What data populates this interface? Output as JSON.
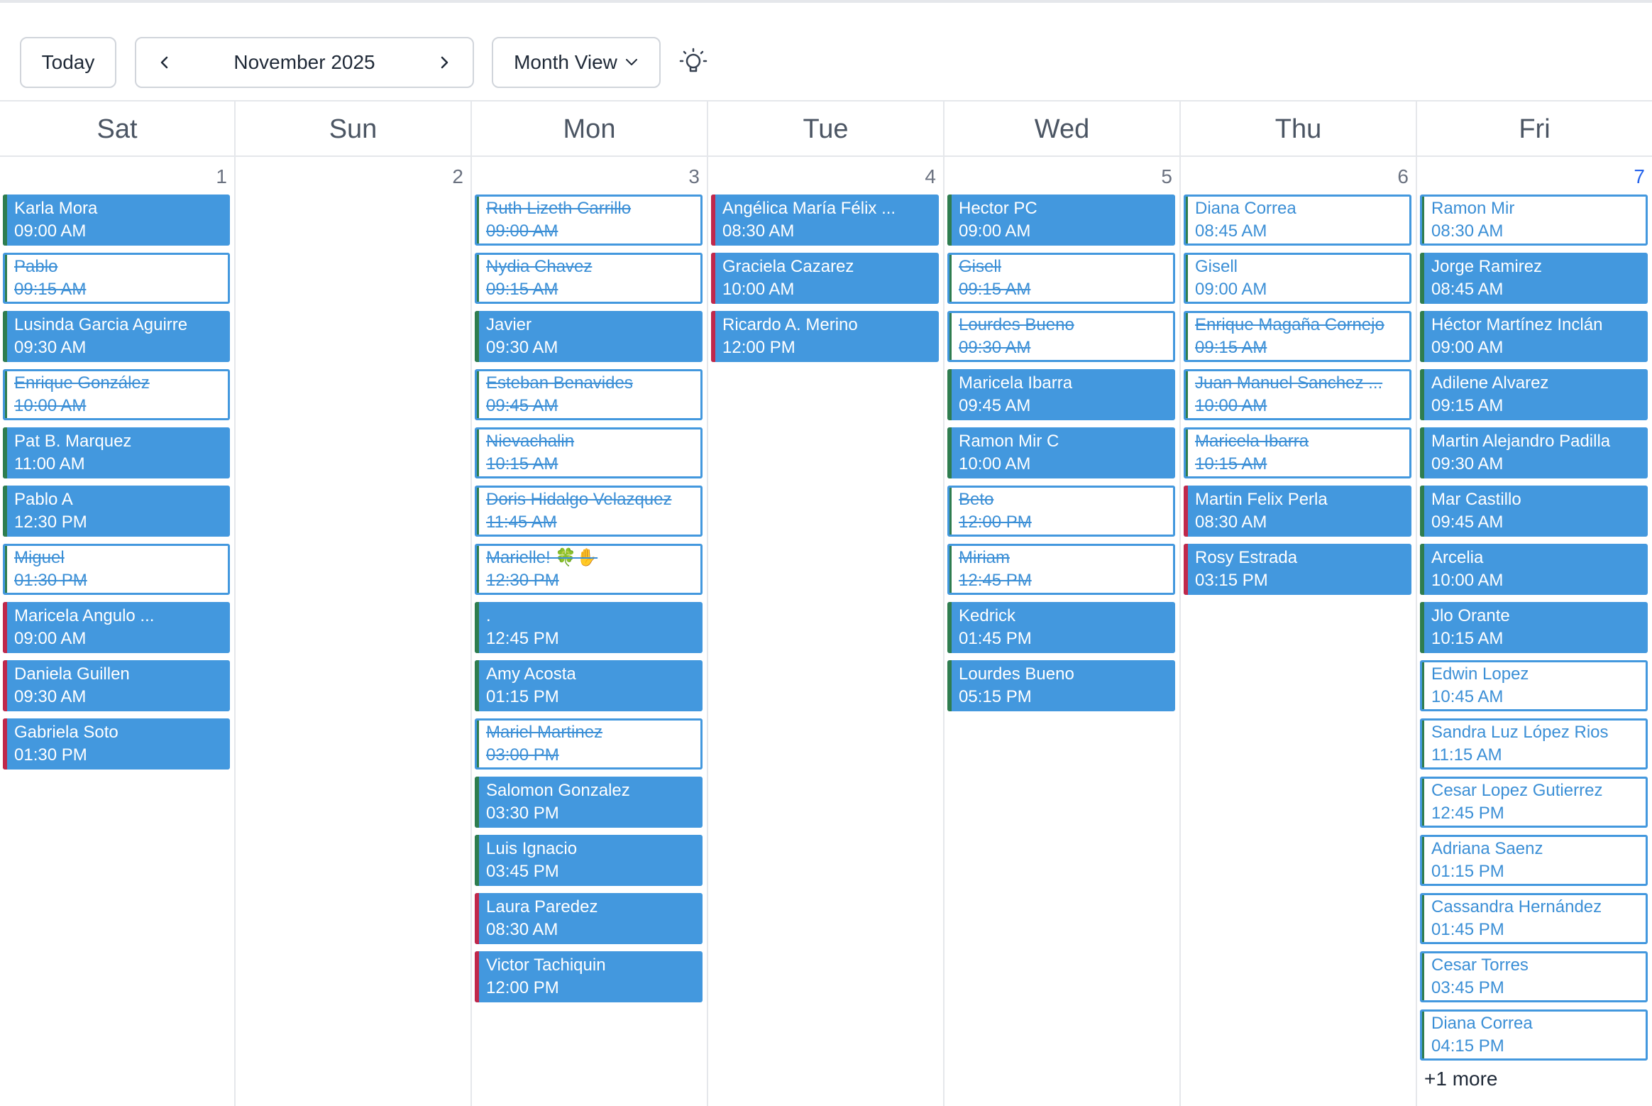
{
  "toolbar": {
    "today_label": "Today",
    "month_label": "November 2025",
    "view_label": "Month View",
    "prev_icon": "chevron-left-icon",
    "next_icon": "chevron-right-icon",
    "view_icon": "chevron-down-icon",
    "theme_icon": "lightbulb-icon"
  },
  "colors": {
    "event_blue": "#4398de",
    "bar_green": "#2f7d4f",
    "bar_red": "#c0284b",
    "today_blue": "#2563eb"
  },
  "weekdays": [
    "Sat",
    "Sun",
    "Mon",
    "Tue",
    "Wed",
    "Thu",
    "Fri"
  ],
  "days": [
    {
      "number": "1",
      "today": false,
      "events": [
        {
          "name": "Karla Mora",
          "time": "09:00 AM",
          "style": "solid",
          "bar": "green",
          "struck": false
        },
        {
          "name": "Pablo",
          "time": "09:15 AM",
          "style": "outline",
          "bar": "green",
          "struck": true
        },
        {
          "name": "Lusinda Garcia Aguirre",
          "time": "09:30 AM",
          "style": "solid",
          "bar": "green",
          "struck": false
        },
        {
          "name": "Enrique González",
          "time": "10:00 AM",
          "style": "outline",
          "bar": "green",
          "struck": true
        },
        {
          "name": "Pat B. Marquez",
          "time": "11:00 AM",
          "style": "solid",
          "bar": "green",
          "struck": false
        },
        {
          "name": "Pablo A",
          "time": "12:30 PM",
          "style": "solid",
          "bar": "green",
          "struck": false
        },
        {
          "name": "Miguel",
          "time": "01:30 PM",
          "style": "outline",
          "bar": "green",
          "struck": true
        },
        {
          "name": "Maricela Angulo ...",
          "time": "09:00 AM",
          "style": "solid",
          "bar": "red",
          "struck": false
        },
        {
          "name": "Daniela Guillen",
          "time": "09:30 AM",
          "style": "solid",
          "bar": "red",
          "struck": false
        },
        {
          "name": "Gabriela Soto",
          "time": "01:30 PM",
          "style": "solid",
          "bar": "red",
          "struck": false
        }
      ]
    },
    {
      "number": "2",
      "today": false,
      "events": []
    },
    {
      "number": "3",
      "today": false,
      "events": [
        {
          "name": "Ruth Lizeth Carrillo",
          "time": "09:00 AM",
          "style": "outline",
          "bar": "green",
          "struck": true
        },
        {
          "name": "Nydia Chavez",
          "time": "09:15 AM",
          "style": "outline",
          "bar": "green",
          "struck": true
        },
        {
          "name": "Javier",
          "time": "09:30 AM",
          "style": "solid",
          "bar": "green",
          "struck": false
        },
        {
          "name": "Esteban Benavides",
          "time": "09:45 AM",
          "style": "outline",
          "bar": "green",
          "struck": true
        },
        {
          "name": "Nievachalin",
          "time": "10:15 AM",
          "style": "outline",
          "bar": "green",
          "struck": true
        },
        {
          "name": "Doris Hidalgo Velazquez",
          "time": "11:45 AM",
          "style": "outline",
          "bar": "green",
          "struck": true
        },
        {
          "name": "Marielle! 🍀✋",
          "time": "12:30 PM",
          "style": "outline",
          "bar": "green",
          "struck": true
        },
        {
          "name": ".",
          "time": "12:45 PM",
          "style": "solid",
          "bar": "green",
          "struck": false
        },
        {
          "name": "Amy Acosta",
          "time": "01:15 PM",
          "style": "solid",
          "bar": "green",
          "struck": false
        },
        {
          "name": "Mariel Martinez",
          "time": "03:00 PM",
          "style": "outline",
          "bar": "green",
          "struck": true
        },
        {
          "name": "Salomon Gonzalez",
          "time": "03:30 PM",
          "style": "solid",
          "bar": "green",
          "struck": false
        },
        {
          "name": "Luis Ignacio",
          "time": "03:45 PM",
          "style": "solid",
          "bar": "green",
          "struck": false
        },
        {
          "name": "Laura Paredez",
          "time": "08:30 AM",
          "style": "solid",
          "bar": "red",
          "struck": false
        },
        {
          "name": "Victor Tachiquin",
          "time": "12:00 PM",
          "style": "solid",
          "bar": "red",
          "struck": false
        }
      ]
    },
    {
      "number": "4",
      "today": false,
      "events": [
        {
          "name": "Angélica María Félix ...",
          "time": "08:30 AM",
          "style": "solid",
          "bar": "red",
          "struck": false
        },
        {
          "name": "Graciela Cazarez",
          "time": "10:00 AM",
          "style": "solid",
          "bar": "red",
          "struck": false
        },
        {
          "name": "Ricardo A. Merino",
          "time": "12:00 PM",
          "style": "solid",
          "bar": "red",
          "struck": false
        }
      ]
    },
    {
      "number": "5",
      "today": false,
      "events": [
        {
          "name": "Hector PC",
          "time": "09:00 AM",
          "style": "solid",
          "bar": "green",
          "struck": false
        },
        {
          "name": "Gisell",
          "time": "09:15 AM",
          "style": "outline",
          "bar": "green",
          "struck": true
        },
        {
          "name": "Lourdes Bueno",
          "time": "09:30 AM",
          "style": "outline",
          "bar": "green",
          "struck": true
        },
        {
          "name": "Maricela Ibarra",
          "time": "09:45 AM",
          "style": "solid",
          "bar": "green",
          "struck": false
        },
        {
          "name": "Ramon Mir C",
          "time": "10:00 AM",
          "style": "solid",
          "bar": "green",
          "struck": false
        },
        {
          "name": "Beto",
          "time": "12:00 PM",
          "style": "outline",
          "bar": "green",
          "struck": true
        },
        {
          "name": "Miriam",
          "time": "12:45 PM",
          "style": "outline",
          "bar": "green",
          "struck": true
        },
        {
          "name": "Kedrick",
          "time": "01:45 PM",
          "style": "solid",
          "bar": "green",
          "struck": false
        },
        {
          "name": "Lourdes Bueno",
          "time": "05:15 PM",
          "style": "solid",
          "bar": "green",
          "struck": false
        }
      ]
    },
    {
      "number": "6",
      "today": false,
      "events": [
        {
          "name": "Diana Correa",
          "time": "08:45 AM",
          "style": "outline",
          "bar": "green",
          "struck": false
        },
        {
          "name": "Gisell",
          "time": "09:00 AM",
          "style": "outline",
          "bar": "green",
          "struck": false
        },
        {
          "name": "Enrique Magaña Cornejo",
          "time": "09:15 AM",
          "style": "outline",
          "bar": "green",
          "struck": true
        },
        {
          "name": "Juan Manuel Sanchez ...",
          "time": "10:00 AM",
          "style": "outline",
          "bar": "green",
          "struck": true
        },
        {
          "name": "Maricela Ibarra",
          "time": "10:15 AM",
          "style": "outline",
          "bar": "green",
          "struck": true
        },
        {
          "name": "Martin Felix Perla",
          "time": "08:30 AM",
          "style": "solid",
          "bar": "red",
          "struck": false
        },
        {
          "name": "Rosy Estrada",
          "time": "03:15 PM",
          "style": "solid",
          "bar": "red",
          "struck": false
        }
      ]
    },
    {
      "number": "7",
      "today": true,
      "events": [
        {
          "name": "Ramon Mir",
          "time": "08:30 AM",
          "style": "outline",
          "bar": "green",
          "struck": false
        },
        {
          "name": "Jorge Ramirez",
          "time": "08:45 AM",
          "style": "solid",
          "bar": "green",
          "struck": false
        },
        {
          "name": "Héctor Martínez Inclán",
          "time": "09:00 AM",
          "style": "solid",
          "bar": "green",
          "struck": false
        },
        {
          "name": "Adilene Alvarez",
          "time": "09:15 AM",
          "style": "solid",
          "bar": "green",
          "struck": false
        },
        {
          "name": "Martin Alejandro Padilla",
          "time": "09:30 AM",
          "style": "solid",
          "bar": "green",
          "struck": false
        },
        {
          "name": "Mar Castillo",
          "time": "09:45 AM",
          "style": "solid",
          "bar": "green",
          "struck": false
        },
        {
          "name": "Arcelia",
          "time": "10:00 AM",
          "style": "solid",
          "bar": "green",
          "struck": false
        },
        {
          "name": "Jlo Orante",
          "time": "10:15 AM",
          "style": "solid",
          "bar": "green",
          "struck": false
        },
        {
          "name": "Edwin Lopez",
          "time": "10:45 AM",
          "style": "outline",
          "bar": "green",
          "struck": false
        },
        {
          "name": "Sandra Luz López Rios",
          "time": "11:15 AM",
          "style": "outline",
          "bar": "green",
          "struck": false
        },
        {
          "name": "Cesar Lopez Gutierrez",
          "time": "12:45 PM",
          "style": "outline",
          "bar": "green",
          "struck": false
        },
        {
          "name": "Adriana Saenz",
          "time": "01:15 PM",
          "style": "outline",
          "bar": "green",
          "struck": false
        },
        {
          "name": "Cassandra Hernández",
          "time": "01:45 PM",
          "style": "outline",
          "bar": "green",
          "struck": false
        },
        {
          "name": "Cesar Torres",
          "time": "03:45 PM",
          "style": "outline",
          "bar": "green",
          "struck": false
        },
        {
          "name": "Diana Correa",
          "time": "04:15 PM",
          "style": "outline",
          "bar": "green",
          "struck": false
        }
      ],
      "more_label": "+1 more"
    }
  ]
}
